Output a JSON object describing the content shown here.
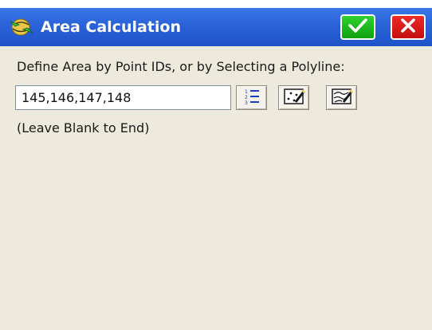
{
  "window": {
    "title": "Area Calculation",
    "title_icon": "globe-arrows-icon",
    "ok_icon": "checkmark-icon",
    "close_icon": "close-x-icon"
  },
  "form": {
    "prompt": "Define Area by Point IDs, or by Selecting a Polyline:",
    "point_ids_value": "145,146,147,148",
    "hint": "(Leave Blank to End)"
  },
  "tools": [
    {
      "name": "list-points",
      "icon": "numbered-list-icon"
    },
    {
      "name": "select-points-on-map",
      "icon": "map-select-points-icon"
    },
    {
      "name": "select-polyline-on-map",
      "icon": "map-select-polyline-icon"
    }
  ],
  "colors": {
    "titlebar": "#2a62d8",
    "background": "#ede9dc",
    "ok_button": "#1cb81c",
    "close_button": "#d81a1a"
  }
}
